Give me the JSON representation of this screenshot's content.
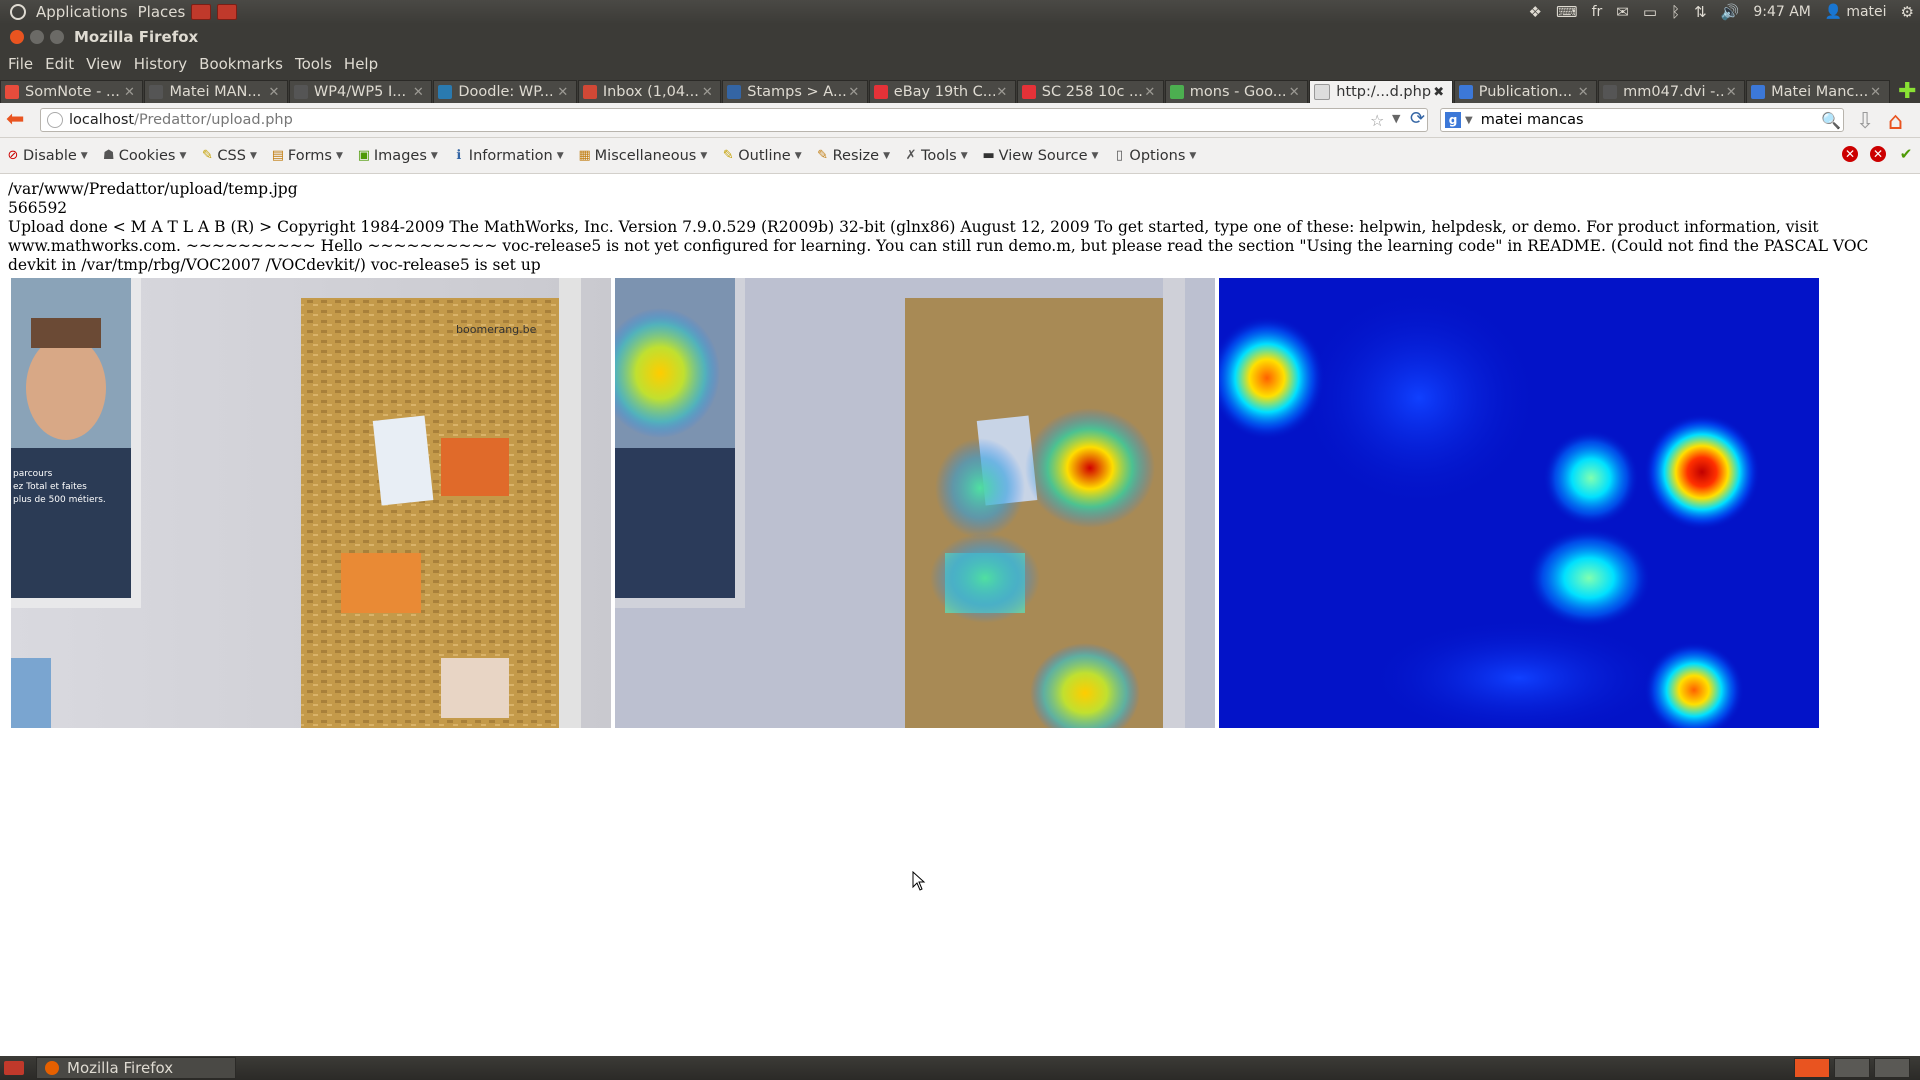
{
  "top_panel": {
    "applications": "Applications",
    "places": "Places",
    "keyboard_layout": "fr",
    "time": "9:47 AM",
    "user": "matei"
  },
  "window": {
    "title": "Mozilla Firefox"
  },
  "menu": [
    "File",
    "Edit",
    "View",
    "History",
    "Bookmarks",
    "Tools",
    "Help"
  ],
  "tabs": [
    {
      "label": "SomNote - ...",
      "favicon_color": "#e74c3c"
    },
    {
      "label": "Matei MAN...",
      "favicon_color": "#555555"
    },
    {
      "label": "WP4/WP5 I...",
      "favicon_color": "#555555"
    },
    {
      "label": "Doodle: WP...",
      "favicon_color": "#2a7ab0"
    },
    {
      "label": "Inbox (1,04...",
      "favicon_color": "#d14836"
    },
    {
      "label": "Stamps > A...",
      "favicon_color": "#3465a4"
    },
    {
      "label": "eBay 19th C...",
      "favicon_color": "#e53238"
    },
    {
      "label": "SC 258 10c ...",
      "favicon_color": "#e53238"
    },
    {
      "label": "mons - Goo...",
      "favicon_color": "#4caf50"
    },
    {
      "label": "http:/...d.php",
      "favicon_color": "#dddddd",
      "active": true
    },
    {
      "label": "Publication...",
      "favicon_color": "#3c78d8"
    },
    {
      "label": "mm047.dvi -...",
      "favicon_color": "#555555"
    },
    {
      "label": "Matei Manc...",
      "favicon_color": "#3c78d8"
    }
  ],
  "address": {
    "host": "localhost",
    "path": "/Predattor/upload.php"
  },
  "search": {
    "engine": "g",
    "query": "matei mancas"
  },
  "devbar": [
    {
      "label": "Disable",
      "icon": "disable-icon",
      "glyph": "⊘",
      "color": "#cc0000"
    },
    {
      "label": "Cookies",
      "icon": "cookies-icon",
      "glyph": "☗",
      "color": "#555555"
    },
    {
      "label": "CSS",
      "icon": "css-icon",
      "glyph": "✎",
      "color": "#c4a000"
    },
    {
      "label": "Forms",
      "icon": "forms-icon",
      "glyph": "▤",
      "color": "#c17d11"
    },
    {
      "label": "Images",
      "icon": "images-icon",
      "glyph": "▣",
      "color": "#4e9a06"
    },
    {
      "label": "Information",
      "icon": "information-icon",
      "glyph": "ℹ",
      "color": "#3465a4"
    },
    {
      "label": "Miscellaneous",
      "icon": "miscellaneous-icon",
      "glyph": "▦",
      "color": "#c17d11"
    },
    {
      "label": "Outline",
      "icon": "outline-icon",
      "glyph": "✎",
      "color": "#c4a000"
    },
    {
      "label": "Resize",
      "icon": "resize-icon",
      "glyph": "✎",
      "color": "#c17d11"
    },
    {
      "label": "Tools",
      "icon": "tools-icon",
      "glyph": "✗",
      "color": "#555555"
    },
    {
      "label": "View Source",
      "icon": "view-source-icon",
      "glyph": "▬",
      "color": "#333333"
    },
    {
      "label": "Options",
      "icon": "options-icon",
      "glyph": "▯",
      "color": "#555555"
    }
  ],
  "content": {
    "line1": "/var/www/Predattor/upload/temp.jpg",
    "line2": "566592",
    "line3": "Upload done < M A T L A B (R) > Copyright 1984-2009 The MathWorks, Inc. Version 7.9.0.529 (R2009b) 32-bit (glnx86) August 12, 2009 To get started, type one of these: helpwin, helpdesk, or demo. For product information, visit www.mathworks.com. ~~~~~~~~~~ Hello ~~~~~~~~~~ voc-release5 is not yet configured for learning. You can still run demo.m, but please read the section \"Using the learning code\" in README. (Could not find the PASCAL VOC devkit in /var/tmp/rbg/VOC2007 /VOCdevkit/) voc-release5 is set up",
    "poster_text_1": "parcours",
    "poster_text_2": "ez Total et faites",
    "poster_text_3": "plus de 500 métiers.",
    "board_brand": "boomerang.be"
  },
  "taskbar": {
    "window_label": "Mozilla Firefox"
  }
}
